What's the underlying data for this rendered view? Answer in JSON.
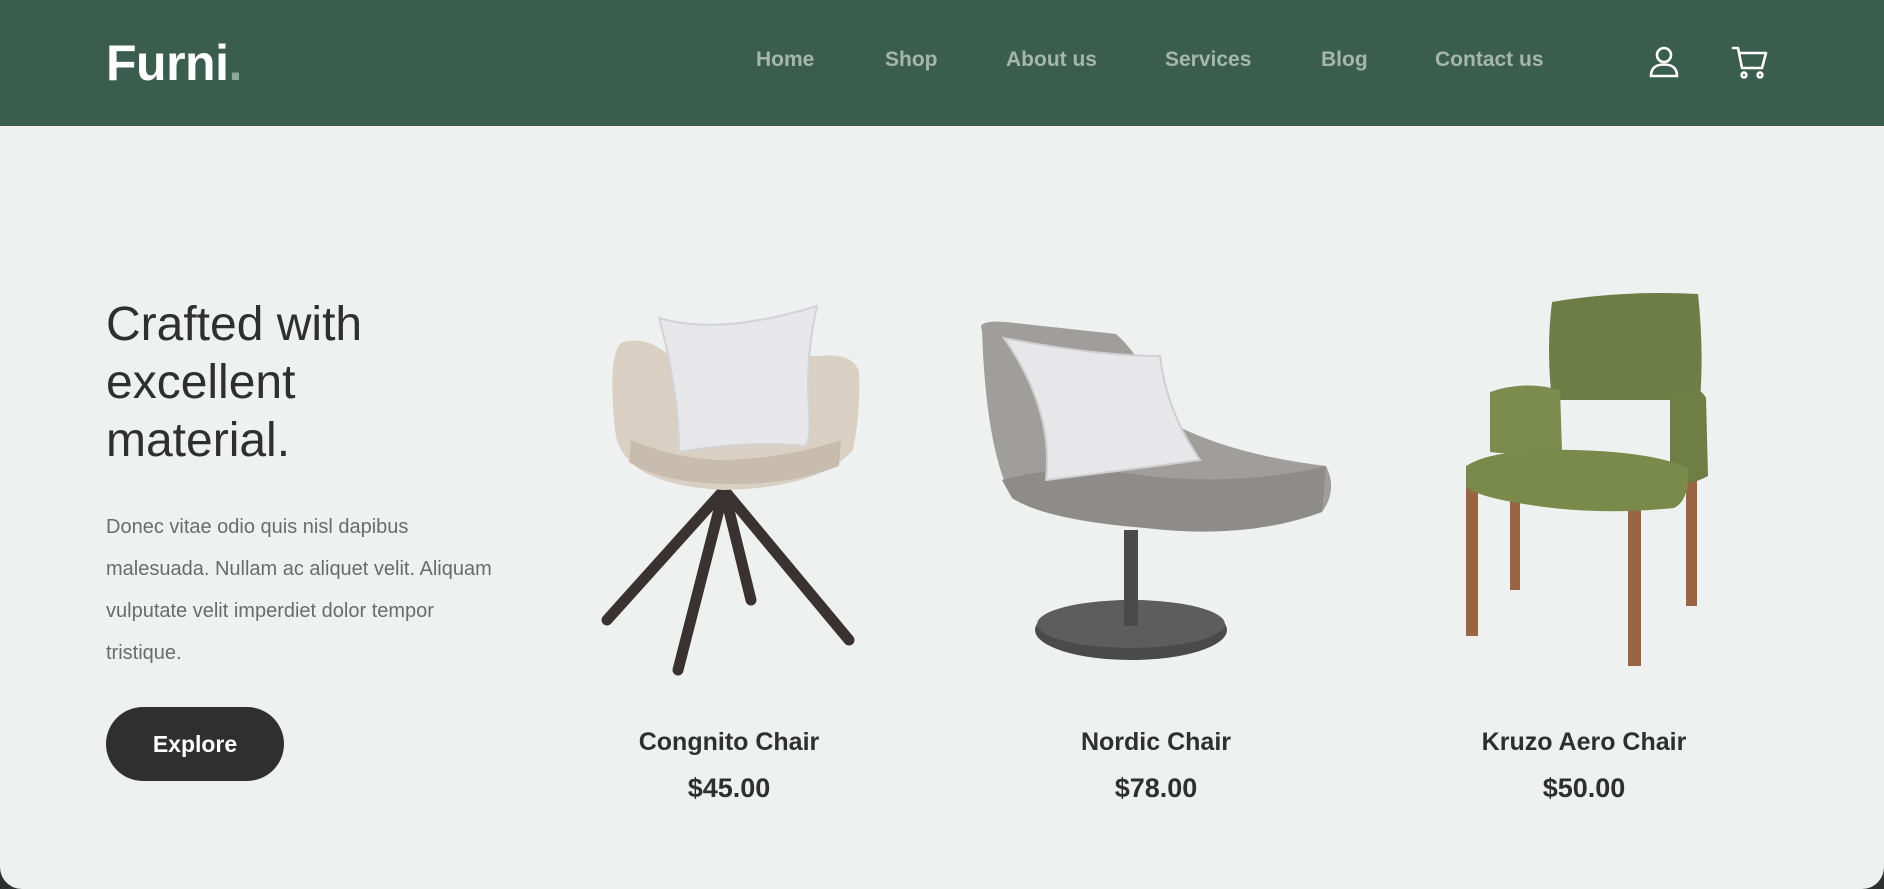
{
  "brand": {
    "name": "Furni",
    "dot": "."
  },
  "nav": {
    "items": [
      "Home",
      "Shop",
      "About us",
      "Services",
      "Blog",
      "Contact us"
    ]
  },
  "header_icons": [
    "user-icon",
    "cart-icon"
  ],
  "colors": {
    "header_bg": "#3b5d50",
    "page_bg": "#eff1f0",
    "nav_text": "#a4b6ae",
    "button_bg": "#2f2f2f"
  },
  "hero": {
    "title": "Crafted with excellent material.",
    "text": "Donec vitae odio quis nisl dapibus malesuada. Nullam ac aliquet velit. Aliquam vulputate velit imperdiet dolor tempor tristique.",
    "button_label": "Explore"
  },
  "products": [
    {
      "name": "Congnito Chair",
      "price": "$45.00"
    },
    {
      "name": "Nordic Chair",
      "price": "$78.00"
    },
    {
      "name": "Kruzo Aero Chair",
      "price": "$50.00"
    }
  ]
}
